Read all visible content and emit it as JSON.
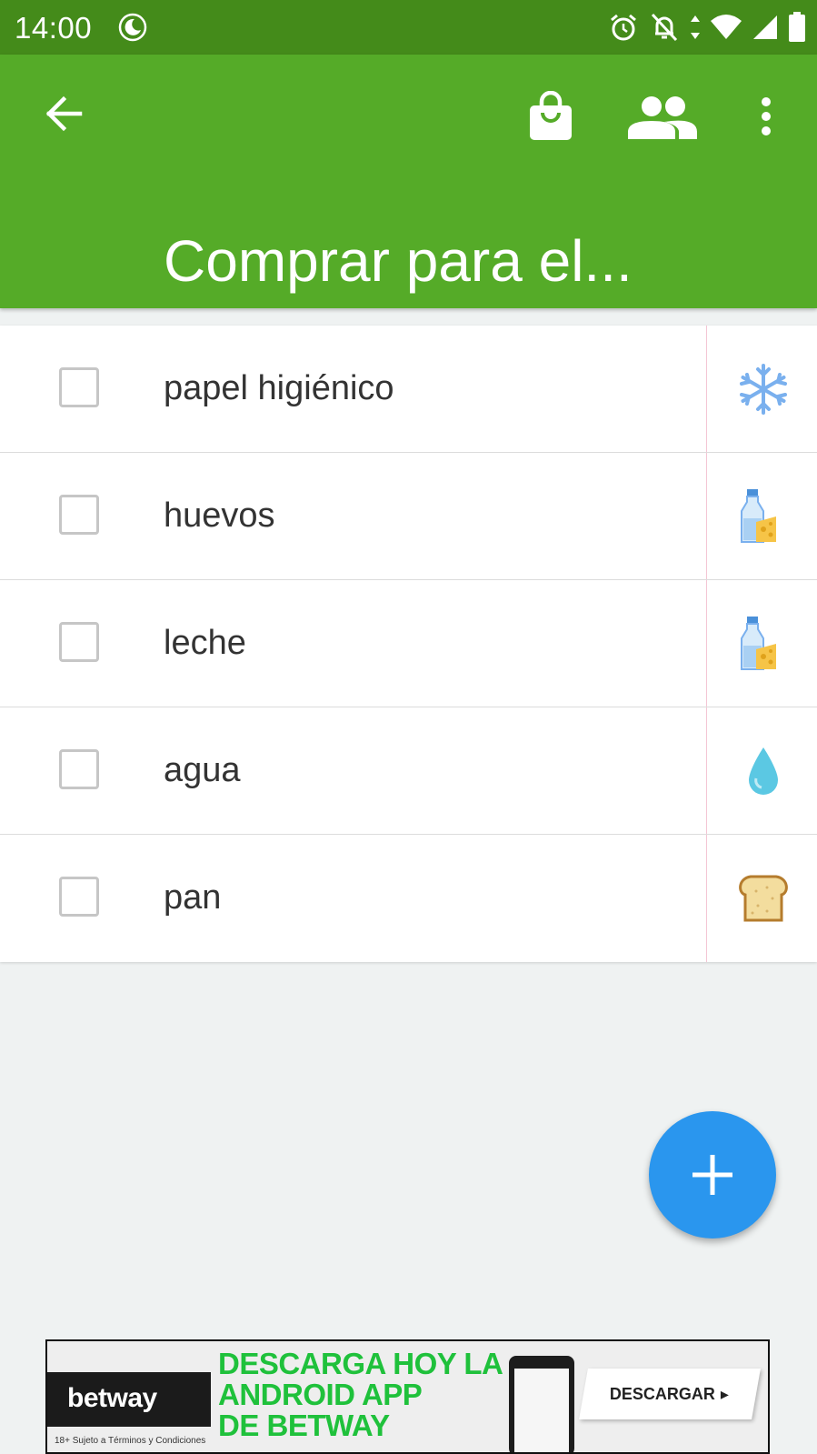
{
  "status_bar": {
    "time": "14:00",
    "icons": [
      "moon-icon",
      "alarm-icon",
      "notifications-off-icon",
      "wifi-icon",
      "signal-icon",
      "battery-icon"
    ]
  },
  "app_bar": {
    "title": "Comprar para el...",
    "color": "#55ab28",
    "actions": [
      "arrow-back-icon",
      "shopping-bag-icon",
      "people-icon",
      "more-vert-icon"
    ]
  },
  "list": {
    "items": [
      {
        "label": "papel higiénico",
        "checked": false,
        "category_icon": "snowflake-icon"
      },
      {
        "label": "huevos",
        "checked": false,
        "category_icon": "milk-cheese-icon"
      },
      {
        "label": "leche",
        "checked": false,
        "category_icon": "milk-cheese-icon"
      },
      {
        "label": "agua",
        "checked": false,
        "category_icon": "water-drop-icon"
      },
      {
        "label": "pan",
        "checked": false,
        "category_icon": "bread-icon"
      }
    ]
  },
  "fab": {
    "icon": "plus-icon",
    "color": "#2a96ee"
  },
  "ad": {
    "brand": "betway",
    "headline": [
      "DESCARGA HOY LA",
      "ANDROID APP",
      "DE BETWAY"
    ],
    "terms": "18+ Sujeto a Términos y Condiciones",
    "cta": "DESCARGAR"
  }
}
